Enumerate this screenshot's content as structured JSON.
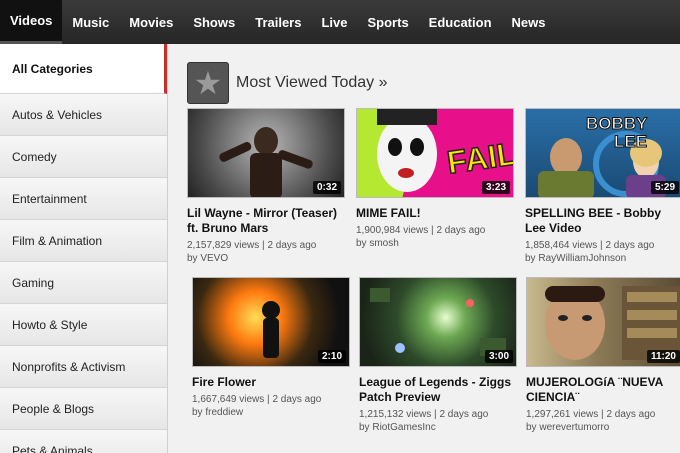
{
  "nav": {
    "tabs": [
      "Videos",
      "Music",
      "Movies",
      "Shows",
      "Trailers",
      "Live",
      "Sports",
      "Education",
      "News"
    ],
    "active": "Videos"
  },
  "sidebar": {
    "categories": [
      "All Categories",
      "Autos & Vehicles",
      "Comedy",
      "Entertainment",
      "Film & Animation",
      "Gaming",
      "Howto & Style",
      "Nonprofits & Activism",
      "People & Blogs",
      "Pets & Animals"
    ]
  },
  "section": {
    "title": "Most Viewed Today »",
    "icon": "star-icon"
  },
  "videos": [
    {
      "title": "Lil Wayne - Mirror (Teaser) ft. Bruno Mars",
      "views": "2,157,829 views",
      "age": "2 days ago",
      "channel": "VEVO",
      "duration": "0:32"
    },
    {
      "title": "MIME FAIL!",
      "views": "1,900,984 views",
      "age": "2 days ago",
      "channel": "smosh",
      "duration": "3:23"
    },
    {
      "title": "SPELLING BEE - Bobby Lee Video",
      "views": "1,858,464 views",
      "age": "2 days ago",
      "channel": "RayWilliamJohnson",
      "duration": "5:29"
    },
    {
      "title": "Fire Flower",
      "views": "1,667,649 views",
      "age": "2 days ago",
      "channel": "freddiew",
      "duration": "2:10"
    },
    {
      "title": "League of Legends - Ziggs Patch Preview",
      "views": "1,215,132 views",
      "age": "2 days ago",
      "channel": "RiotGamesInc",
      "duration": "3:00"
    },
    {
      "title": "MUJEROLOGíA ¨NUEVA CIENCIA¨",
      "views": "1,297,261 views",
      "age": "2 days ago",
      "channel": "werevertumorro",
      "duration": "11:20"
    }
  ],
  "thumb_text": {
    "fail": "FAIL",
    "bobby": "BOBBY",
    "lee": "LEE"
  },
  "by_prefix": "by"
}
